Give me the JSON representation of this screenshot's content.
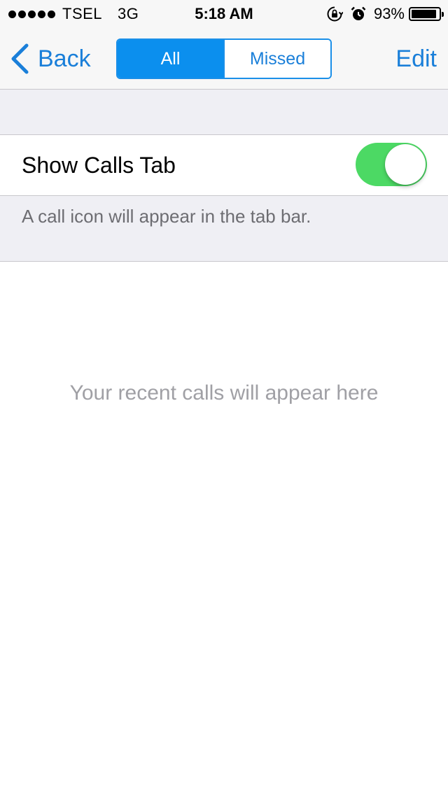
{
  "status_bar": {
    "carrier": "TSEL",
    "network": "3G",
    "time": "5:18 AM",
    "battery_percent": "93%",
    "battery_level": 0.93
  },
  "nav": {
    "back_label": "Back",
    "segments": [
      "All",
      "Missed"
    ],
    "selected_segment": "All",
    "edit_label": "Edit",
    "accent_color": "#1a7fd9"
  },
  "settings": {
    "toggle_label": "Show Calls Tab",
    "toggle_on": true,
    "toggle_color": "#4cd964",
    "footer_text": "A call icon will appear in the tab bar."
  },
  "empty_state": {
    "message": "Your recent calls will appear here"
  }
}
